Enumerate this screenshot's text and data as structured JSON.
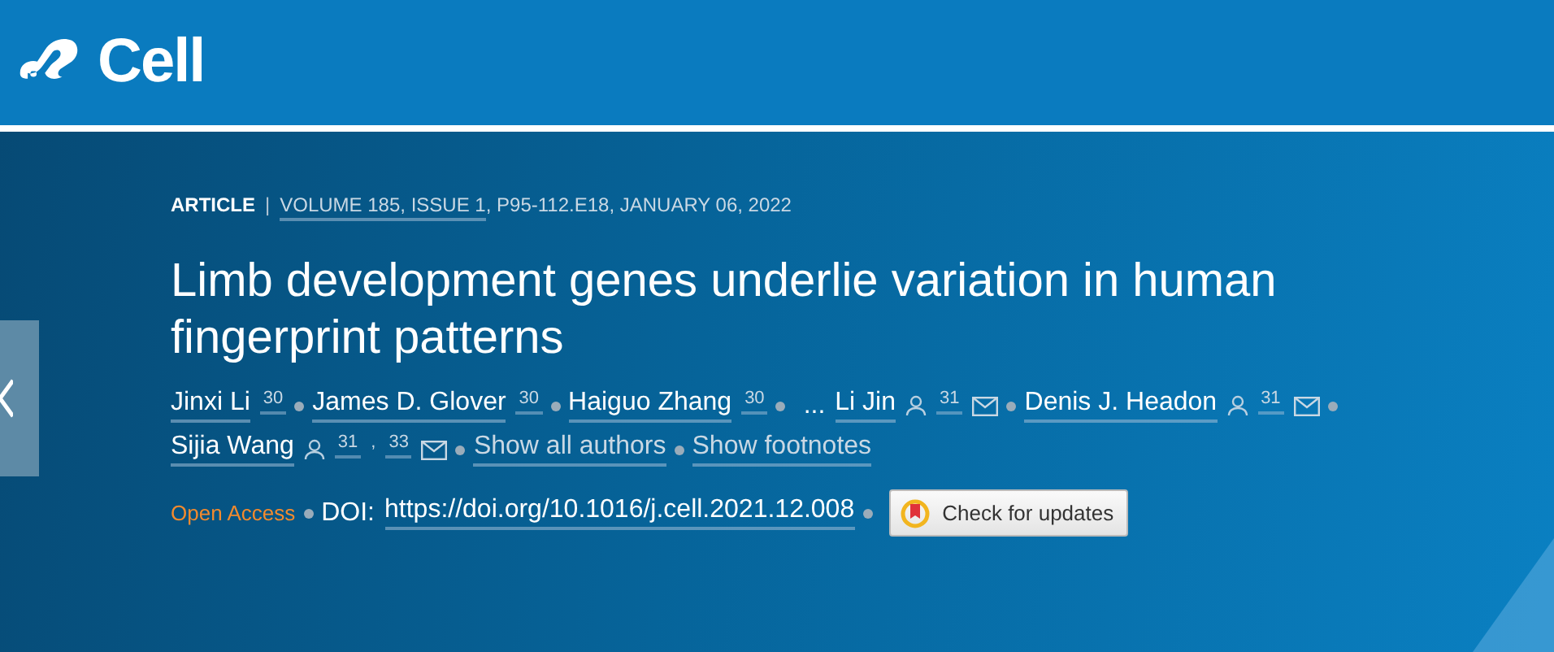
{
  "header": {
    "brand": "Cell"
  },
  "article": {
    "type": "ARTICLE",
    "separator": "|",
    "volume_link": "VOLUME 185, ISSUE 1",
    "citation": ", P95-112.E18, JANUARY 06, 2022",
    "title": "Limb development genes underlie variation in human fingerprint patterns",
    "byline": [
      {
        "kind": "author",
        "name": "Jinxi Li",
        "refs": [
          "30"
        ],
        "profile": false,
        "email": false
      },
      {
        "kind": "author",
        "name": "James D. Glover",
        "refs": [
          "30"
        ],
        "profile": false,
        "email": false
      },
      {
        "kind": "author",
        "name": "Haiguo Zhang",
        "refs": [
          "30"
        ],
        "profile": false,
        "email": false
      },
      {
        "kind": "ellipsis",
        "text": "..."
      },
      {
        "kind": "author",
        "name": "Li Jin",
        "refs": [
          "31"
        ],
        "profile": true,
        "email": true
      },
      {
        "kind": "author",
        "name": "Denis J. Headon",
        "refs": [
          "31"
        ],
        "profile": true,
        "email": true
      },
      {
        "kind": "author",
        "name": "Sijia Wang",
        "refs": [
          "31",
          "33"
        ],
        "profile": true,
        "email": true
      },
      {
        "kind": "link",
        "text": "Show all authors"
      },
      {
        "kind": "link",
        "text": "Show footnotes"
      }
    ],
    "refs_separator": ",",
    "access": "Open Access",
    "doi_label": "DOI:",
    "doi": "https://doi.org/10.1016/j.cell.2021.12.008",
    "updates_button": "Check for updates"
  }
}
